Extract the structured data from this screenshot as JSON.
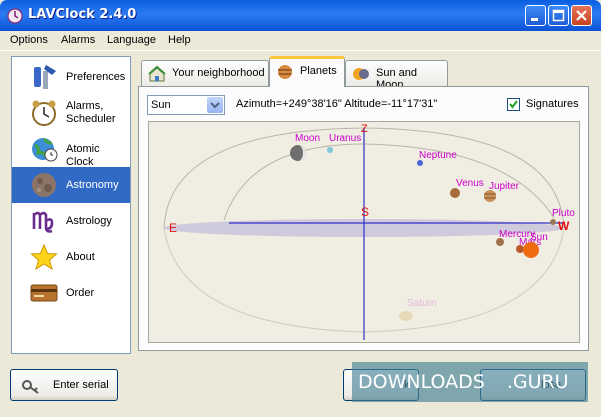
{
  "window": {
    "title": "LAVClock 2.4.0"
  },
  "menu": [
    "Options",
    "Alarms",
    "Language",
    "Help"
  ],
  "sidebar": {
    "items": [
      {
        "label": "Preferences",
        "icon": "tools-icon"
      },
      {
        "label": "Alarms,\nScheduler",
        "icon": "alarm-clock-icon"
      },
      {
        "label": "Atomic Clock",
        "icon": "globe-clock-icon"
      },
      {
        "label": "Astronomy",
        "icon": "moon-icon",
        "active": true
      },
      {
        "label": "Astrology",
        "icon": "virgo-icon"
      },
      {
        "label": "About",
        "icon": "star-icon"
      },
      {
        "label": "Order",
        "icon": "credit-card-icon"
      }
    ]
  },
  "tabs": [
    {
      "label": "Your neighborhood",
      "icon": "house-icon"
    },
    {
      "label": "Planets",
      "icon": "planet-icon",
      "active": true
    },
    {
      "label": "Sun and Moon",
      "icon": "sun-moon-icon"
    }
  ],
  "planets_panel": {
    "object_select": "Sun",
    "azimuth_altitude": "Azimuth=+249°38'16\"  Altitude=-11°17'31\"",
    "signatures_label": "Signatures",
    "signatures_checked": true
  },
  "sky": {
    "directions": {
      "zenith": "Z",
      "south": "S",
      "east": "E",
      "west": "W"
    },
    "bodies": [
      "Moon",
      "Uranus",
      "Neptune",
      "Venus",
      "Jupiter",
      "Pluto",
      "Mercury",
      "Mars",
      "Sun",
      "Saturn"
    ],
    "colors": {
      "label": "#CC00CC",
      "direction": "#E01010",
      "meridian": "#3030C8",
      "grid": "#B8B4A8"
    }
  },
  "buttons": {
    "enter_serial": "Enter serial",
    "ok_partial": "k",
    "close_partial": "lose"
  },
  "watermark": {
    "text": "DOWNLOADS",
    "suffix": ".GURU"
  }
}
